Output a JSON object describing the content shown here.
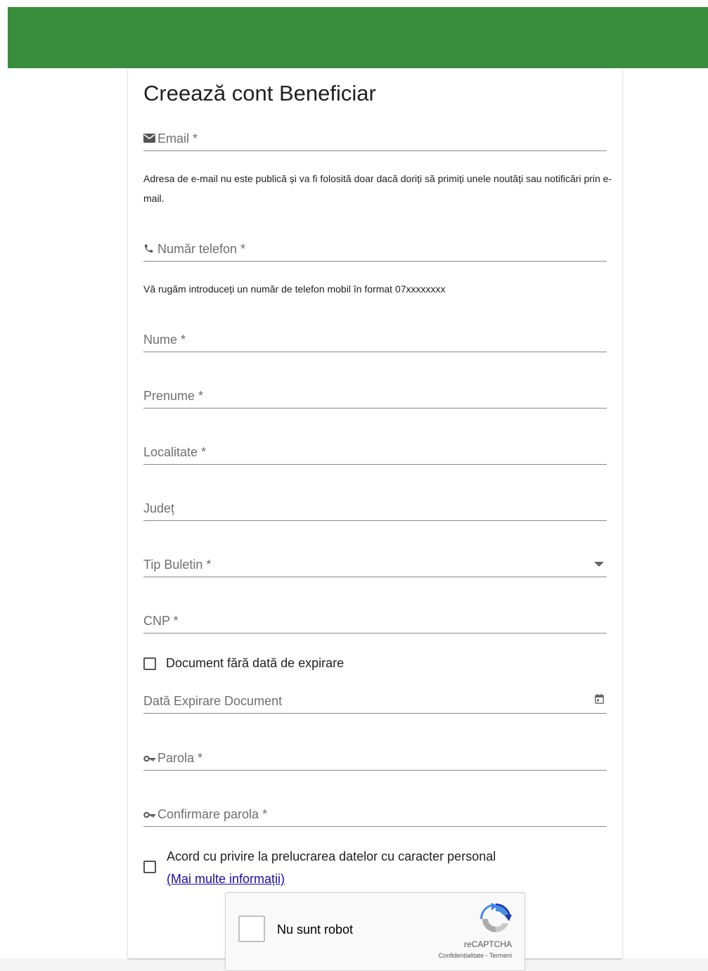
{
  "header": {
    "color": "#388e3c"
  },
  "form": {
    "title": "Creează cont Beneficiar",
    "email": {
      "label": "Email *",
      "icon": "email-icon"
    },
    "email_helper": "Adresa de e-mail nu este publică și va fi folosită doar dacă doriți să primiți unele noutăți sau notificări prin e-mail.",
    "phone": {
      "label": "Număr telefon *",
      "icon": "phone-icon"
    },
    "phone_helper": "Vă rugăm introduceți un număr de telefon mobil în format 07xxxxxxxx",
    "last_name": {
      "label": "Nume *"
    },
    "first_name": {
      "label": "Prenume *"
    },
    "city": {
      "label": "Localitate *"
    },
    "county": {
      "label": "Județ"
    },
    "id_type": {
      "label": "Tip Buletin *",
      "icon": "dropdown-arrow-icon"
    },
    "cnp": {
      "label": "CNP *"
    },
    "no_expiry": {
      "label": "Document fără dată de expirare",
      "checked": false
    },
    "expiry_date": {
      "label": "Dată Expirare Document",
      "icon": "calendar-icon"
    },
    "password": {
      "label": "Parola *",
      "icon": "key-icon"
    },
    "confirm_password": {
      "label": "Confirmare parola *",
      "icon": "key-icon"
    },
    "consent": {
      "label": "Acord cu privire la prelucrarea datelor cu caracter personal",
      "link": "(Mai multe informații)",
      "checked": false
    },
    "recaptcha": {
      "label": "Nu sunt robot",
      "brand": "reCAPTCHA",
      "terms": "Confidențialitate - Termeni"
    }
  }
}
